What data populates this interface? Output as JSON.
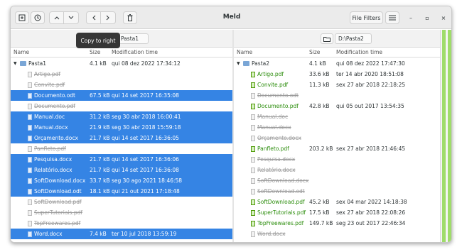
{
  "window": {
    "title": "Meld"
  },
  "toolbar": {
    "file_filters_label": "File Filters",
    "icons": [
      "expand-icon",
      "history-icon",
      "chevron-up-icon",
      "chevron-down-icon",
      "arrow-left-icon",
      "arrow-right-icon",
      "trash-icon",
      "hamburger-menu-icon"
    ]
  },
  "window_controls": {
    "minimize": "–",
    "maximize": "▫",
    "close": "×"
  },
  "tooltip": {
    "text": "Copy to right"
  },
  "left": {
    "path_text": "Pasta1",
    "columns": {
      "name": "Name",
      "size": "Size",
      "modified": "Modification time"
    },
    "root": {
      "name": "Pasta1",
      "size": "4.1 kB",
      "modified": "qui 08 dez 2022 17:34:12"
    },
    "rows": [
      {
        "name": "Artigo.pdf",
        "size": "",
        "modified": "",
        "state": "missing"
      },
      {
        "name": "Convite.pdf",
        "size": "",
        "modified": "",
        "state": "missing"
      },
      {
        "name": "Documento.odt",
        "size": "67.5 kB",
        "modified": "qui 14 set 2017 16:35:08",
        "state": "selected"
      },
      {
        "name": "Documento.pdf",
        "size": "",
        "modified": "",
        "state": "missing"
      },
      {
        "name": "Manual.doc",
        "size": "31.2 kB",
        "modified": "seg 30 abr 2018 16:00:41",
        "state": "selected"
      },
      {
        "name": "Manual.docx",
        "size": "21.9 kB",
        "modified": "seg 30 abr 2018 15:59:18",
        "state": "selected"
      },
      {
        "name": "Orçamento.docx",
        "size": "21.7 kB",
        "modified": "qui 14 set 2017 16:36:05",
        "state": "selected"
      },
      {
        "name": "Panfleto.pdf",
        "size": "",
        "modified": "",
        "state": "missing"
      },
      {
        "name": "Pesquisa.docx",
        "size": "21.7 kB",
        "modified": "qui 14 set 2017 16:36:06",
        "state": "selected"
      },
      {
        "name": "Relatório.docx",
        "size": "21.7 kB",
        "modified": "qui 14 set 2017 16:36:08",
        "state": "selected"
      },
      {
        "name": "SoftDownload.docx",
        "size": "33.7 kB",
        "modified": "seg 30 ago 2021 18:46:58",
        "state": "selected"
      },
      {
        "name": "SoftDownload.odt",
        "size": "18.1 kB",
        "modified": "qui 21 out 2021 17:18:48",
        "state": "selected"
      },
      {
        "name": "SoftDownload.pdf",
        "size": "",
        "modified": "",
        "state": "missing"
      },
      {
        "name": "SuperTutoriais.pdf",
        "size": "",
        "modified": "",
        "state": "missing"
      },
      {
        "name": "TopFreewares.pdf",
        "size": "",
        "modified": "",
        "state": "missing"
      },
      {
        "name": "Word.docx",
        "size": "7.4 kB",
        "modified": "ter 10 jul 2018 13:59:19",
        "state": "selected"
      }
    ]
  },
  "right": {
    "path_text": "D:\\Pasta2",
    "columns": {
      "name": "Name",
      "size": "Size",
      "modified": "Modification time"
    },
    "root": {
      "name": "Pasta2",
      "size": "4.1 kB",
      "modified": "qui 08 dez 2022 17:47:30"
    },
    "rows": [
      {
        "name": "Artigo.pdf",
        "size": "33.6 kB",
        "modified": "ter 14 abr 2020 18:51:08",
        "state": "new"
      },
      {
        "name": "Convite.pdf",
        "size": "11.3 kB",
        "modified": "sex 27 abr 2018 22:18:25",
        "state": "new"
      },
      {
        "name": "Documento.odt",
        "size": "",
        "modified": "",
        "state": "missing"
      },
      {
        "name": "Documento.pdf",
        "size": "42.8 kB",
        "modified": "qui 05 out 2017 13:54:35",
        "state": "new"
      },
      {
        "name": "Manual.doc",
        "size": "",
        "modified": "",
        "state": "missing"
      },
      {
        "name": "Manual.docx",
        "size": "",
        "modified": "",
        "state": "missing"
      },
      {
        "name": "Orçamento.docx",
        "size": "",
        "modified": "",
        "state": "missing"
      },
      {
        "name": "Panfleto.pdf",
        "size": "203.2 kB",
        "modified": "sex 27 abr 2018 21:46:45",
        "state": "new"
      },
      {
        "name": "Pesquisa.docx",
        "size": "",
        "modified": "",
        "state": "missing"
      },
      {
        "name": "Relatório.docx",
        "size": "",
        "modified": "",
        "state": "missing"
      },
      {
        "name": "SoftDownload.docx",
        "size": "",
        "modified": "",
        "state": "missing"
      },
      {
        "name": "SoftDownload.odt",
        "size": "",
        "modified": "",
        "state": "missing"
      },
      {
        "name": "SoftDownload.pdf",
        "size": "45.2 kB",
        "modified": "sex 04 mar 2022 14:18:38",
        "state": "new"
      },
      {
        "name": "SuperTutoriais.pdf",
        "size": "17.5 kB",
        "modified": "sex 27 abr 2018 22:08:26",
        "state": "new"
      },
      {
        "name": "TopFreewares.pdf",
        "size": "149.7 kB",
        "modified": "seg 23 out 2017 22:46:34",
        "state": "new"
      },
      {
        "name": "Word.docx",
        "size": "",
        "modified": "",
        "state": "missing"
      }
    ]
  },
  "colors": {
    "selection": "#3584e4",
    "new_file": "#2a8c0a",
    "diff_strip": "#9fdc6a"
  }
}
